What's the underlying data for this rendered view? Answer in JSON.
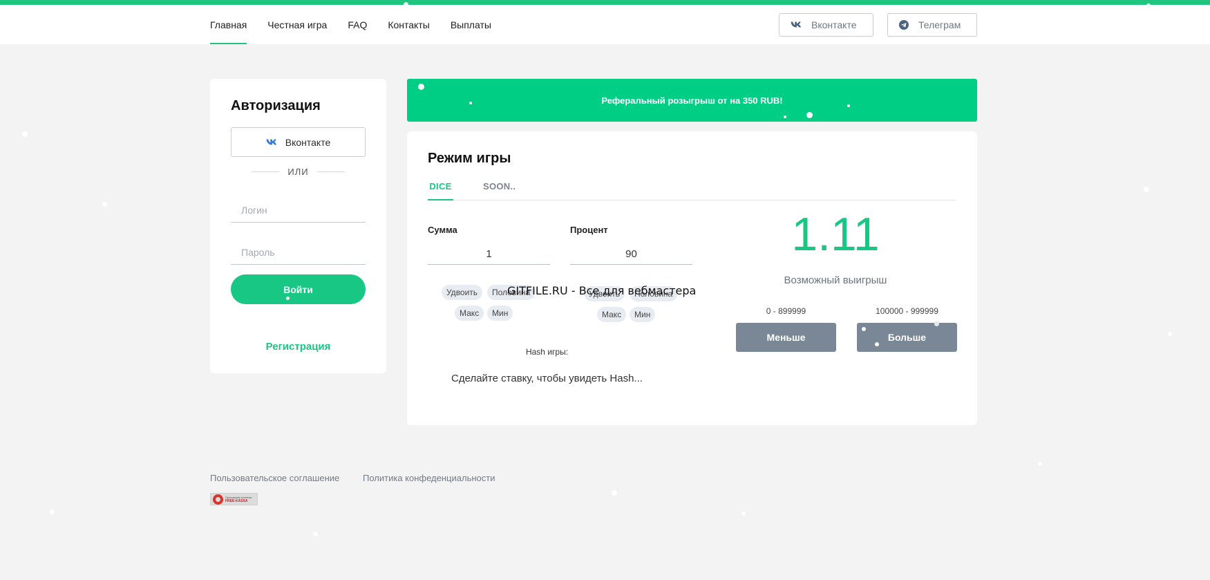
{
  "header": {
    "nav": [
      {
        "label": "Главная",
        "active": true
      },
      {
        "label": "Честная игра",
        "active": false
      },
      {
        "label": "FAQ",
        "active": false
      },
      {
        "label": "Контакты",
        "active": false
      },
      {
        "label": "Выплаты",
        "active": false
      }
    ],
    "vk_label": "Вконтакте",
    "telegram_label": "Телеграм"
  },
  "auth": {
    "title": "Авторизация",
    "vk_button_label": "Вконтакте",
    "or_text": "ИЛИ",
    "login_placeholder": "Логин",
    "password_placeholder": "Пароль",
    "login_button": "Войти",
    "register_link": "Регистрация"
  },
  "promo": {
    "text": "Реферальный розыгрыш от на 350 RUB!"
  },
  "game": {
    "title": "Режим игры",
    "tabs": [
      "DICE",
      "SOON.."
    ],
    "sum_label": "Сумма",
    "sum_value": "1",
    "percent_label": "Процент",
    "percent_value": "90",
    "sum_chips": [
      "Удвоить",
      "Половина",
      "Макс",
      "Мин"
    ],
    "percent_chips": [
      "Удвоить",
      "Половина",
      "Макс",
      "Мин"
    ],
    "hash_label": "Hash игры:",
    "hash_value": "Сделайте ставку, чтобы увидеть Hash...",
    "coefficient": "1.11",
    "possible_win_label": "Возможный выигрыш",
    "range_low": "0 - 899999",
    "range_high": "100000 - 999999",
    "less_button": "Меньше",
    "more_button": "Больше"
  },
  "watermark": "GITFILE.RU - Все для вебмастера",
  "footer": {
    "links": [
      "Пользовательское соглашение",
      "Политика конфеденциальности"
    ],
    "freekassa_small": "Принимаем платежи",
    "freekassa_name": "FREE-KASSA"
  },
  "colors": {
    "accent": "#17c783",
    "promo_bg": "#00ce85",
    "page_bg": "#f3f3f3",
    "bet_button_bg": "#7a8796"
  }
}
